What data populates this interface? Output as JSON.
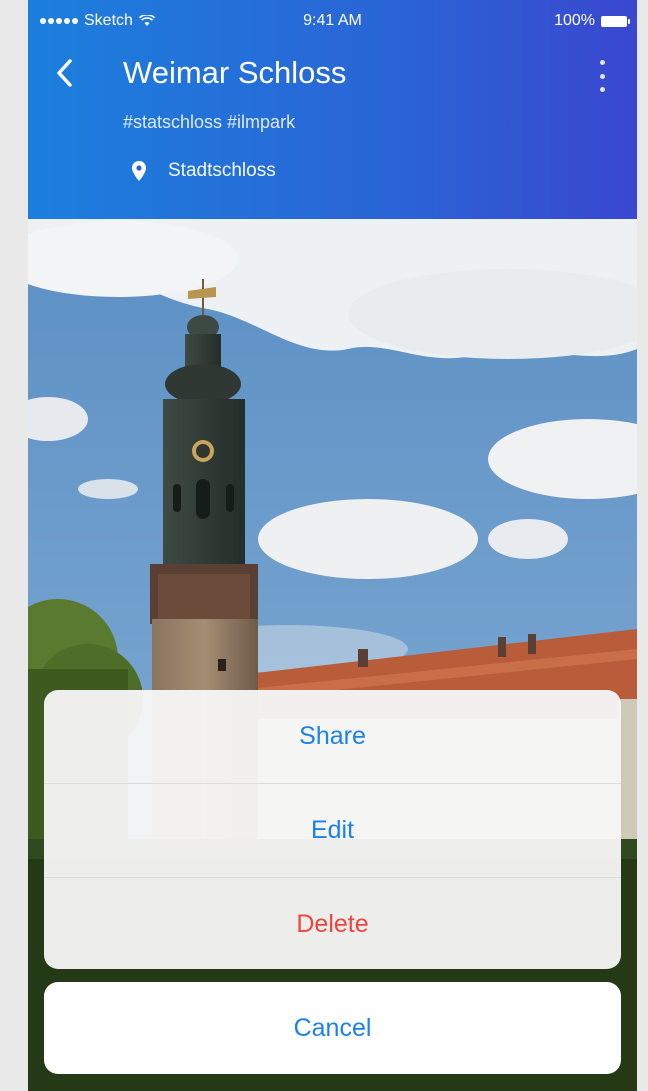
{
  "status_bar": {
    "carrier": "Sketch",
    "time": "9:41 AM",
    "battery": "100%"
  },
  "header": {
    "title": "Weimar Schloss",
    "tags": "#statschloss #ilmpark",
    "location": "Stadtschloss"
  },
  "action_sheet": {
    "share_label": "Share",
    "edit_label": "Edit",
    "delete_label": "Delete",
    "cancel_label": "Cancel"
  },
  "colors": {
    "header_start": "#1c7fdd",
    "header_end": "#3a47cf",
    "action_blue": "#1a82e8",
    "destructive_red": "#f0453e"
  },
  "icons": {
    "back": "chevron-left-icon",
    "more": "more-vertical-icon",
    "location": "map-pin-icon",
    "wifi": "wifi-icon",
    "battery": "battery-icon"
  }
}
